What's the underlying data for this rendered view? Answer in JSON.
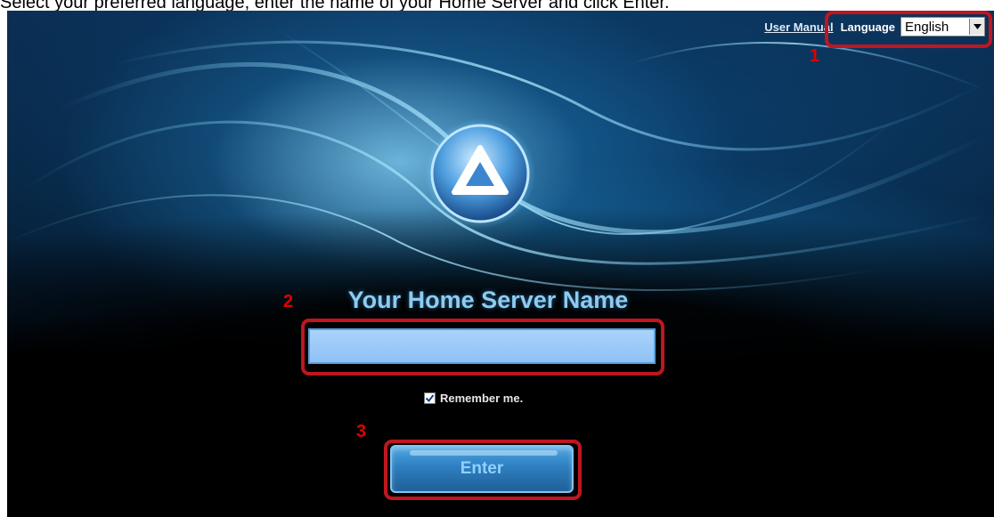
{
  "caption": "Select your preferred language, enter the name of your Home Server and click Enter.",
  "topbar": {
    "user_manual": "User Manual",
    "language_label": "Language",
    "language_value": "English"
  },
  "form": {
    "title": "Your Home Server Name",
    "server_name_value": "",
    "remember_label": "Remember me.",
    "remember_checked": true,
    "enter_label": "Enter"
  },
  "callouts": [
    "1",
    "2",
    "3"
  ],
  "icons": {
    "logo": "server-logo-icon",
    "dropdown": "chevron-down-icon",
    "check": "check-icon"
  },
  "colors": {
    "callout": "#c0161f",
    "callout_number": "#e00000",
    "title": "#8ecbf0",
    "input_bg": "#a9d3fb",
    "button": "#2e7fc0"
  }
}
